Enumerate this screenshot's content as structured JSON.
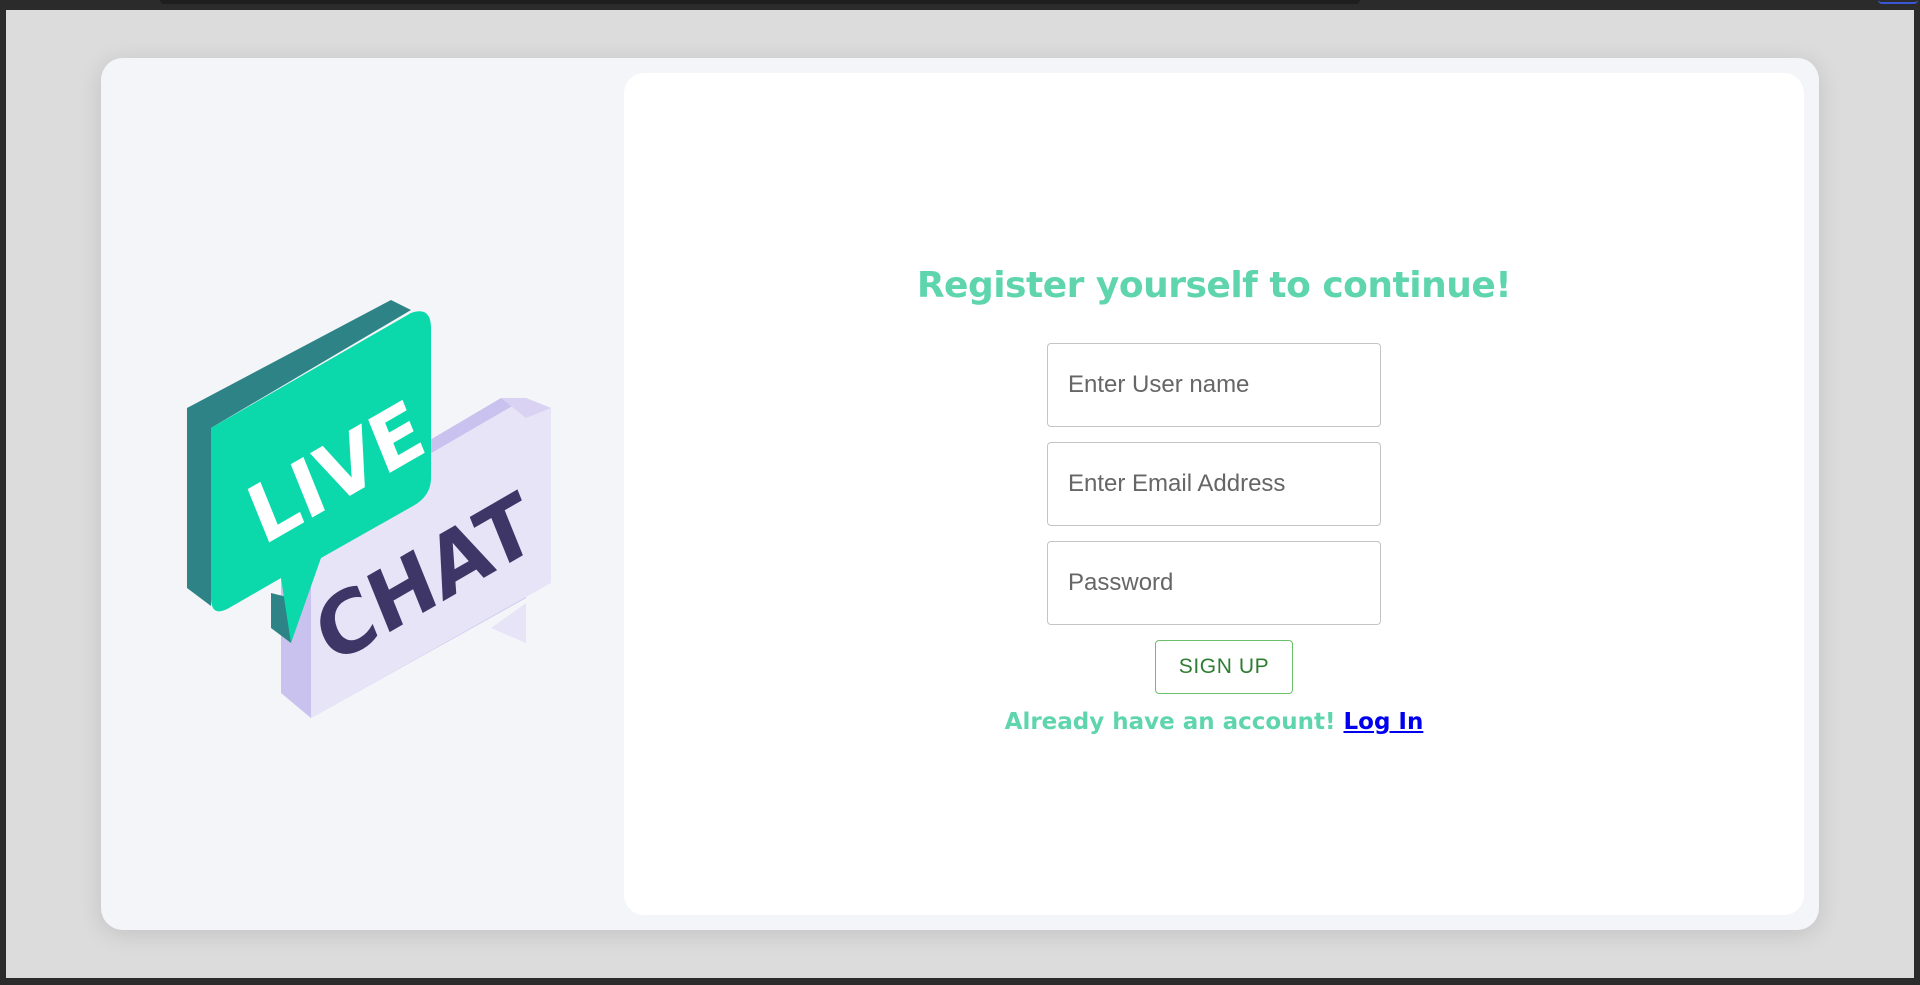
{
  "logo": {
    "word1": "LIVE",
    "word2": "CHAT",
    "colors": {
      "front_bubble": "#0bd9ab",
      "front_bubble_side": "#2e8386",
      "back_bubble": "#e8e4f7",
      "back_bubble_side": "#c9c1ee",
      "chat_text": "#3f3668"
    }
  },
  "form": {
    "heading": "Register yourself to continue!",
    "username_placeholder": "Enter User name",
    "email_placeholder": "Enter Email Address",
    "password_placeholder": "Password",
    "signup_label": "SIGN UP",
    "already_text": "Already have an account!",
    "login_link": "Log In"
  },
  "colors": {
    "accent": "#5fd5ad",
    "link": "#0000ee",
    "button_text": "#2e7d32",
    "button_border": "#6bbf6b",
    "card_bg": "#f3f5f8",
    "panel_bg": "#ffffff"
  }
}
